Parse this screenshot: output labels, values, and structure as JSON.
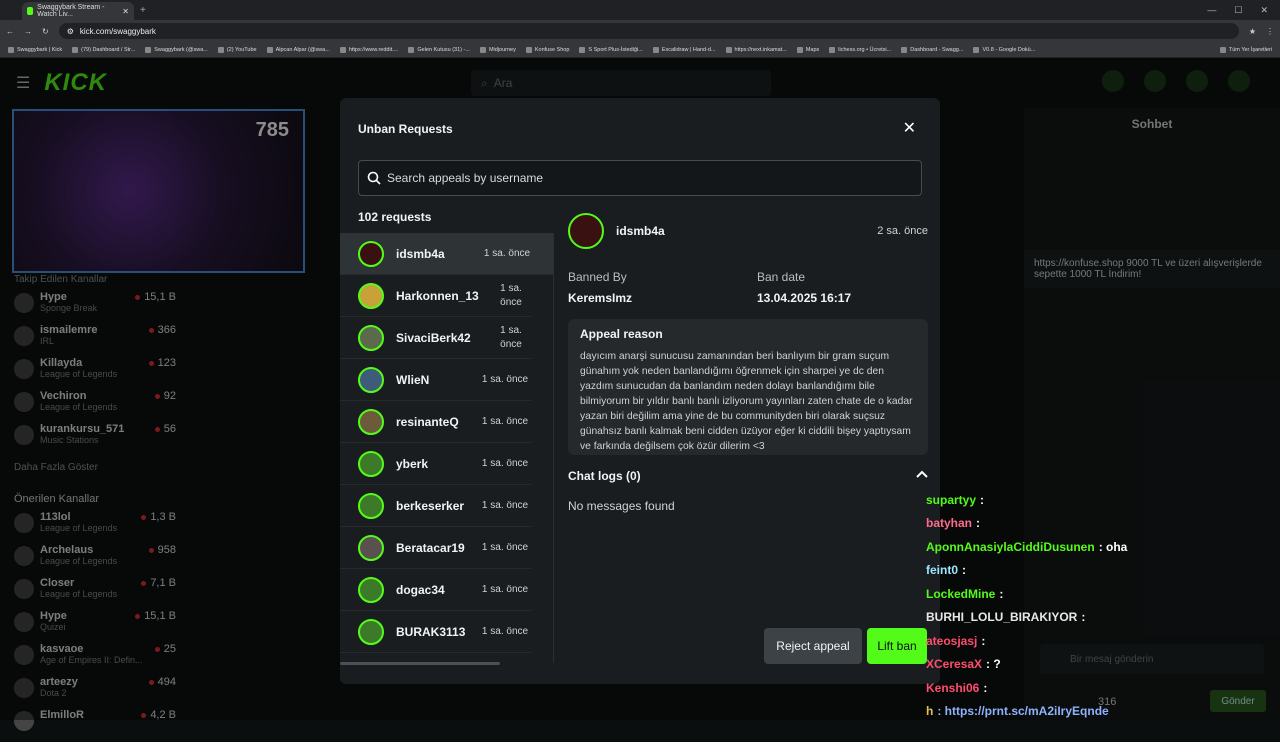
{
  "browser": {
    "tab_title": "Swaggybark Stream - Watch Liv...",
    "url": "kick.com/swaggybark",
    "bookmarks": [
      "Swaggybark | Kick",
      "(79) Dashboard / Str...",
      "Swaggybark (@swa...",
      "(2) YouTube",
      "Alpcan Alpar (@swa...",
      "https://www.reddit....",
      "Gelen Kutusu (31) -...",
      "Midjourney",
      "Konfuse Shop",
      "S Sport Plus-İstediği...",
      "Excalidraw | Hand-d...",
      "https://next.inkamat...",
      "Maps",
      "lichess.org • Ücretsi...",
      "Dashboard - Swagg...",
      "V0.8 - Google Dokü...",
      "Tüm Yer İşaretleri"
    ]
  },
  "topnav": {
    "logo": "KICK",
    "search_placeholder": "Ara"
  },
  "video": {
    "counter": "785"
  },
  "sidebar": {
    "followed_heading": "Takip Edilen Kanallar",
    "followed": [
      {
        "name": "Hype",
        "category": "Sponge Break",
        "viewers": "15,1 B"
      },
      {
        "name": "ismailemre",
        "category": "IRL",
        "viewers": "366"
      },
      {
        "name": "Killayda",
        "category": "League of Legends",
        "viewers": "123"
      },
      {
        "name": "Vechiron",
        "category": "League of Legends",
        "viewers": "92"
      },
      {
        "name": "kurankursu_571",
        "category": "Music Stations",
        "viewers": "56"
      }
    ],
    "show_more": "Daha Fazla Göster",
    "recommended_heading": "Önerilen Kanallar",
    "recommended": [
      {
        "name": "113lol",
        "category": "League of Legends",
        "viewers": "1,3 B"
      },
      {
        "name": "Archelaus",
        "category": "League of Legends",
        "viewers": "958"
      },
      {
        "name": "Closer",
        "category": "League of Legends",
        "viewers": "7,1 B"
      },
      {
        "name": "Hype",
        "category": "Quizei",
        "viewers": "15,1 B"
      },
      {
        "name": "kasvaoe",
        "category": "Age of Empires II: Defin...",
        "viewers": "25"
      },
      {
        "name": "arteezy",
        "category": "Dota 2",
        "viewers": "494"
      },
      {
        "name": "ElmilloR",
        "category": "",
        "viewers": "4,2 B"
      }
    ]
  },
  "chat": {
    "title": "Sohbet",
    "pinned": "https://konfuse.shop 9000 TL ve üzeri alışverişlerde sepette 1000 TL İndirim!",
    "input_placeholder": "Bir mesaj gönderin",
    "send_label": "Gönder",
    "viewer_count": "316"
  },
  "modal": {
    "title": "Unban Requests",
    "search_placeholder": "Search appeals by username",
    "request_count": "102 requests",
    "requests": [
      {
        "name": "idsmb4a",
        "time": "1 sa. önce"
      },
      {
        "name": "Harkonnen_13",
        "time": "1 sa. önce"
      },
      {
        "name": "SivaciBerk42",
        "time": "1 sa. önce"
      },
      {
        "name": "WlieN",
        "time": "1 sa. önce"
      },
      {
        "name": "resinanteQ",
        "time": "1 sa. önce"
      },
      {
        "name": "yberk",
        "time": "1 sa. önce"
      },
      {
        "name": "berkeserker",
        "time": "1 sa. önce"
      },
      {
        "name": "Beratacar19",
        "time": "1 sa. önce"
      },
      {
        "name": "dogac34",
        "time": "1 sa. önce"
      },
      {
        "name": "BURAK3113",
        "time": "1 sa. önce"
      }
    ],
    "detail": {
      "username": "idsmb4a",
      "time": "2 sa. önce",
      "banned_by_label": "Banned By",
      "banned_by": "KeremsImz",
      "ban_date_label": "Ban date",
      "ban_date": "13.04.2025 16:17",
      "appeal_reason_label": "Appeal reason",
      "appeal_reason": "dayıcım anarşi sunucusu zamanından beri banlıyım bir gram suçum günahım yok neden banlandığımı öğrenmek için sharpei ye dc den yazdım sunucudan da banlandım neden dolayı banlandığımı bile bilmiyorum bir yıldır banlı banlı izliyorum yayınları zaten chate de o kadar yazan biri değilim ama yine de bu communityden biri olarak suçsuz günahsız banlı kalmak beni cidden üzüyor eğer ki ciddili bişey yaptıysam ve farkında değilsem çok özür dilerim <3",
      "chat_logs_label": "Chat logs (0)",
      "no_messages": "No messages found"
    },
    "reject_label": "Reject appeal",
    "lift_label": "Lift ban"
  },
  "overlay_chat": [
    {
      "user": "supartyy",
      "msg": ":"
    },
    {
      "user": "batyhan",
      "msg": ":"
    },
    {
      "user": "AponnAnasiylaCiddiDusunen",
      "msg": ": oha"
    },
    {
      "user": "feint0",
      "msg": ":"
    },
    {
      "user": "LockedMine",
      "msg": ":"
    },
    {
      "user": "BURHI_LOLU_BIRAKIYOR",
      "msg": ":"
    },
    {
      "user": "ateosjasj",
      "msg": ":"
    },
    {
      "user": "XCeresaX",
      "msg": ": ?"
    },
    {
      "user": "Kenshi06",
      "msg": ":"
    },
    {
      "user": "h",
      "msg": ": https://prnt.sc/mA2iIryEqnde"
    }
  ]
}
